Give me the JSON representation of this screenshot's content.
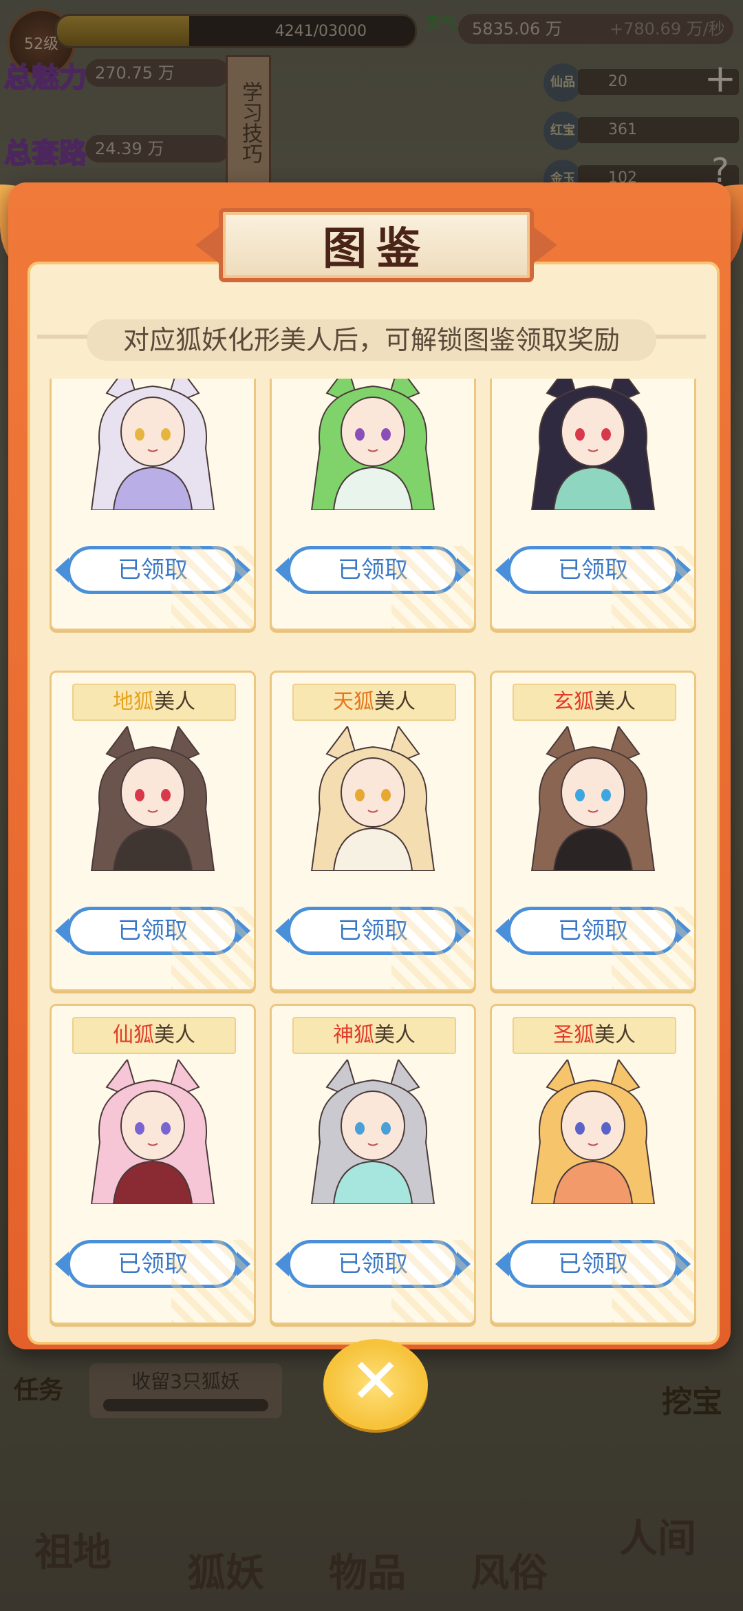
{
  "hud": {
    "level": "52级",
    "exp_text": "4241/03000",
    "exp_progress": 0.37,
    "charm_label": "总魅力",
    "charm_value": "270.75 万",
    "qi_label": "总套路",
    "qi_value": "24.39 万",
    "skill_scroll": "学习技巧",
    "lingqi_label": "灵气",
    "lingqi_value": "5835.06 万",
    "lingqi_rate": "+780.69 万/秒",
    "resources": [
      {
        "label": "仙品",
        "value": "20"
      },
      {
        "label": "红宝",
        "value": "361"
      },
      {
        "label": "金玉",
        "value": "102"
      }
    ],
    "plus_icon": "plus-icon",
    "help_icon": "help-icon"
  },
  "modal": {
    "title": "图鉴",
    "hint": "对应狐妖化形美人后，可解锁图鉴领取奖励",
    "cards": [
      {
        "tier": "",
        "suffix": "",
        "button": "已领取",
        "tier_color": "#e23b2a",
        "hair": "#e8e2f0",
        "outfit": "#b9aee6",
        "eyes": "#e6b540"
      },
      {
        "tier": "",
        "suffix": "",
        "button": "已领取",
        "tier_color": "#e23b2a",
        "hair": "#7fd36a",
        "outfit": "#e9f4ec",
        "eyes": "#8a4fb8"
      },
      {
        "tier": "",
        "suffix": "",
        "button": "已领取",
        "tier_color": "#e23b2a",
        "hair": "#2f2a3f",
        "outfit": "#8fd6c0",
        "eyes": "#d9384a"
      },
      {
        "tier": "地狐",
        "suffix": "美人",
        "button": "已领取",
        "tier_color": "#e8a21e",
        "hair": "#6b544c",
        "outfit": "#3f3632",
        "eyes": "#d9384a"
      },
      {
        "tier": "天狐",
        "suffix": "美人",
        "button": "已领取",
        "tier_color": "#e8751e",
        "hair": "#f4ddb0",
        "outfit": "#f7f1e4",
        "eyes": "#e6a830"
      },
      {
        "tier": "玄狐",
        "suffix": "美人",
        "button": "已领取",
        "tier_color": "#e23b2a",
        "hair": "#8a6652",
        "outfit": "#2a2424",
        "eyes": "#3da6e0"
      },
      {
        "tier": "仙狐",
        "suffix": "美人",
        "button": "已领取",
        "tier_color": "#e23b2a",
        "hair": "#f7c6d6",
        "outfit": "#8a2a32",
        "eyes": "#7a64d0"
      },
      {
        "tier": "神狐",
        "suffix": "美人",
        "button": "已领取",
        "tier_color": "#e23b2a",
        "hair": "#c9c9cf",
        "outfit": "#a6e6de",
        "eyes": "#4a9fd6"
      },
      {
        "tier": "圣狐",
        "suffix": "美人",
        "button": "已领取",
        "tier_color": "#e23b2a",
        "hair": "#f6c46a",
        "outfit": "#f29a6a",
        "eyes": "#5a64c8"
      }
    ],
    "close_icon": "close-icon",
    "close_glyph": "✕"
  },
  "bottom": {
    "task_label": "任务",
    "task_text": "收留3只狐妖",
    "treasure_label": "挖宝",
    "nav": [
      "祖地",
      "狐妖",
      "物品",
      "风俗",
      "人间"
    ]
  }
}
